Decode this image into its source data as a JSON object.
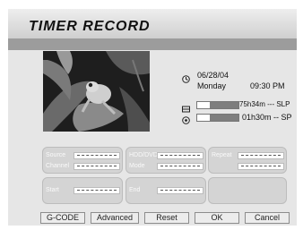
{
  "header": {
    "title": "TIMER RECORD"
  },
  "schedule": {
    "date": "06/28/04",
    "weekday": "Monday",
    "time": "09:30 PM",
    "remaining_tape": "75h34m --- SLP",
    "remaining_fraction": 0.3,
    "record_length": "01h30m -- SP",
    "record_fraction": 0.3
  },
  "fields": {
    "source_label": "Source",
    "channel_label": "Channel",
    "hddvd_label": "HDD/DVD",
    "mode_label": "Mode",
    "repeat_label": "Repeat",
    "start_label": "Start",
    "end_label": "End"
  },
  "buttons": {
    "gcode": "G-CODE",
    "advanced": "Advanced",
    "reset": "Reset",
    "ok": "OK",
    "cancel": "Cancel"
  },
  "icons": {
    "clock": "clock-icon",
    "hdd": "hdd-icon",
    "disc": "disc-icon"
  }
}
